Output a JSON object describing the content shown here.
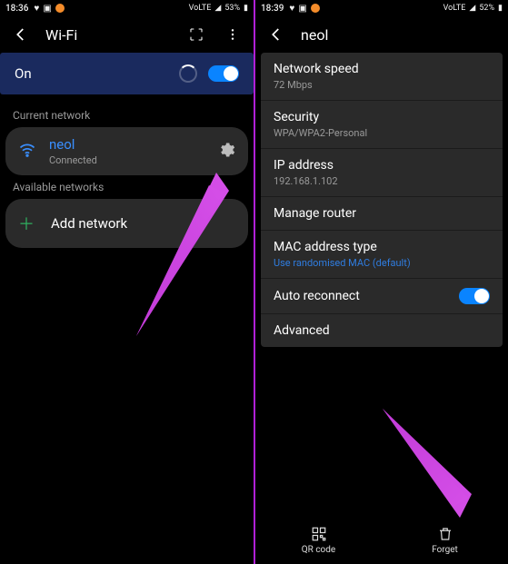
{
  "left": {
    "status": {
      "time": "18:36",
      "battery": "53%",
      "net_indicator": "VoLTE"
    },
    "header": {
      "title": "Wi-Fi"
    },
    "wifi_on": {
      "label": "On"
    },
    "current_label": "Current network",
    "network": {
      "name": "neol",
      "status": "Connected"
    },
    "available_label": "Available networks",
    "add_label": "Add network"
  },
  "right": {
    "status": {
      "time": "18:39",
      "battery": "52%",
      "net_indicator": "VoLTE"
    },
    "header": {
      "title": "neol"
    },
    "rows": {
      "speed_k": "Network speed",
      "speed_v": "72 Mbps",
      "security_k": "Security",
      "security_v": "WPA/WPA2-Personal",
      "ip_k": "IP address",
      "ip_v": "192.168.1.102",
      "manage_k": "Manage router",
      "mac_k": "MAC address type",
      "mac_v": "Use randomised MAC (default)",
      "auto_k": "Auto reconnect",
      "advanced_k": "Advanced"
    },
    "bottom": {
      "qr": "QR code",
      "forget": "Forget"
    }
  }
}
